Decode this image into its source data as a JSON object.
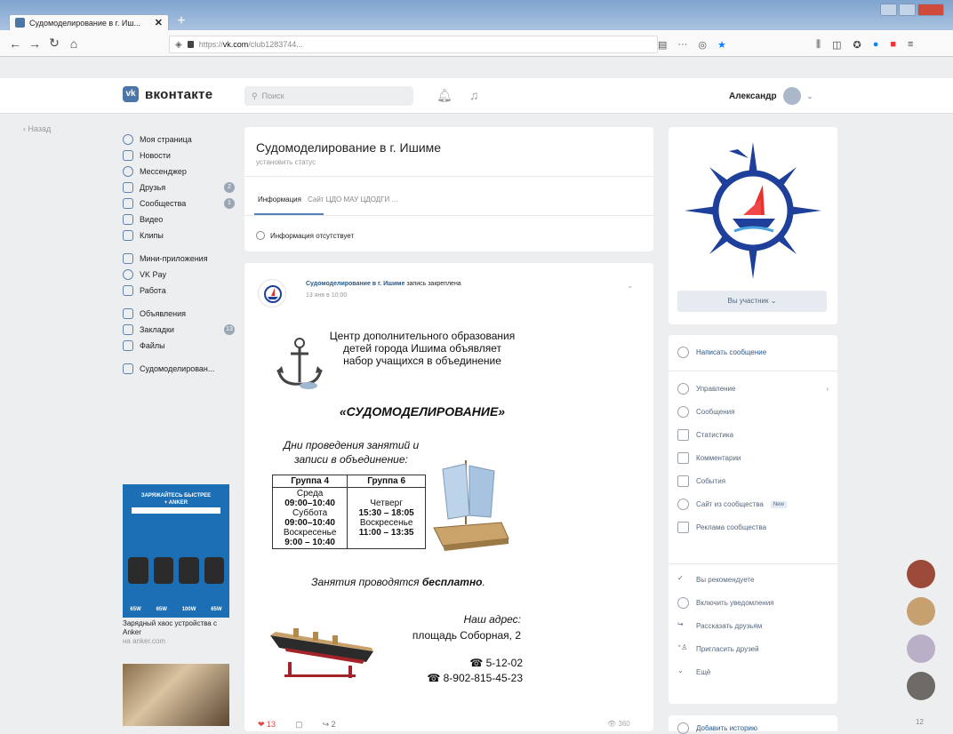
{
  "browser": {
    "tab_title": "Судомоделирование в г. Иш...",
    "url_prefix": "https://",
    "url_domain": "vk.com",
    "url_path": "/club1283744...",
    "url_more": "···"
  },
  "vk": {
    "logo_text": "вконтакте",
    "search_placeholder": "Поиск",
    "user_name": "Александр"
  },
  "left": {
    "back": "Назад",
    "menu": [
      {
        "label": "Моя страница"
      },
      {
        "label": "Новости"
      },
      {
        "label": "Мессенджер"
      },
      {
        "label": "Друзья",
        "count": "2"
      },
      {
        "label": "Сообщества",
        "count": "1"
      },
      {
        "label": "Видео"
      },
      {
        "label": "Клипы"
      }
    ],
    "menu2": [
      {
        "label": "Мини-приложения"
      },
      {
        "label": "VK Pay"
      },
      {
        "label": "Работа"
      }
    ],
    "menu3": [
      {
        "label": "Объявления"
      },
      {
        "label": "Закладки",
        "count": "13"
      },
      {
        "label": "Файлы"
      }
    ],
    "menu4": [
      {
        "label": "Судомоделирован..."
      }
    ],
    "ad": {
      "headline": "ЗАРЯЖАЙТЕСЬ БЫСТРЕЕ",
      "brand": "+ ANKER",
      "labels": [
        "65W",
        "65W",
        "100W",
        "65W"
      ],
      "text": "Зарядный хаос устройства с Anker",
      "sub": "на anker.com"
    }
  },
  "group": {
    "title": "Судомоделирование в г. Ишиме",
    "status": "установить статус",
    "tab_info": "Информация",
    "tab_site": "Сайт ЦДО МАУ ЦДОДГИ ...",
    "no_info": "Информация отсутствует"
  },
  "post": {
    "author": "Судомоделирование в г. Ишиме",
    "pinned": "запись закреплена",
    "date": "13 янв в 10:00",
    "flyer": {
      "intro": "Центр дополнительного образования детей города Ишима объявляет набор учащихся в объединение",
      "program": "«СУДОМОДЕЛИРОВАНИЕ»",
      "days_title": "Дни проведения занятий и записи в объединение:",
      "groups": [
        "Группа 4",
        "Группа 6"
      ],
      "group4": [
        "Среда",
        "09:00–10:40",
        "Суббота",
        "09:00–10:40",
        "Воскресенье",
        "9:00 – 10:40"
      ],
      "group6": [
        "Четверг",
        "15:30 – 18:05",
        "Воскресенье",
        "11:00 – 13:35"
      ],
      "free_prefix": "Занятия проводятся ",
      "free_word": "бесплатно",
      "address_label": "Наш адрес:",
      "address": "площадь Соборная, 2",
      "phone1": "☎ 5-12-02",
      "phone2": "☎ 8-902-815-45-23"
    },
    "likes": "13",
    "reposts": "2",
    "views": "360"
  },
  "right": {
    "member_button": "Вы участник",
    "actions": [
      {
        "label": "Написать сообщение",
        "icon": "chat-icon"
      },
      {
        "label": "Управление",
        "icon": "gear-icon"
      },
      {
        "label": "Сообщения",
        "icon": "chat-icon"
      },
      {
        "label": "Статистика",
        "icon": "stats-icon"
      },
      {
        "label": "Комментарии",
        "icon": "comment-icon"
      },
      {
        "label": "События",
        "icon": "calendar-icon"
      },
      {
        "label": "Сайт из сообщества",
        "icon": "globe-icon",
        "badge": "New"
      },
      {
        "label": "Реклама сообщества",
        "icon": "megaphone-icon"
      },
      {
        "label": "Вы рекомендуете",
        "icon": "check-icon"
      },
      {
        "label": "Включить уведомления",
        "icon": "bell-icon"
      },
      {
        "label": "Рассказать друзьям",
        "icon": "share-icon"
      },
      {
        "label": "Пригласить друзей",
        "icon": "add-person-icon"
      },
      {
        "label": "Ещё",
        "icon": "chevron-down-icon"
      }
    ],
    "add_story": "Добавить историю",
    "friends_count": "12"
  },
  "colors": {
    "vk_blue": "#4a76a8",
    "link": "#2a5885",
    "bg": "#edeef0"
  }
}
